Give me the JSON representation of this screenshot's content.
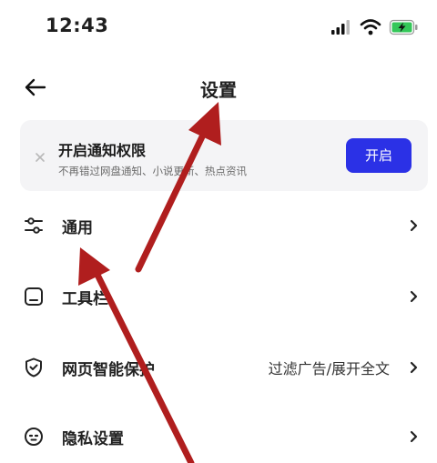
{
  "status_bar": {
    "time": "12:43",
    "icons": [
      "signal-icon",
      "wifi-icon",
      "battery-charging-icon"
    ],
    "battery_color": "#34c759"
  },
  "header": {
    "title": "设置",
    "back_icon": "back-arrow-icon"
  },
  "notification_card": {
    "title": "开启通知权限",
    "subtitle": "不再错过网盘通知、小说更新、热点资讯",
    "button_label": "开启",
    "button_color": "#2b31e6",
    "close_icon": "close-icon"
  },
  "menu": {
    "items": [
      {
        "label": "通用",
        "value": "",
        "icon": "sliders-icon"
      },
      {
        "label": "工具栏",
        "value": "",
        "icon": "toolbar-icon"
      },
      {
        "label": "网页智能保护",
        "value": "过滤广告/展开全文",
        "icon": "shield-check-icon"
      },
      {
        "label": "隐私设置",
        "value": "",
        "icon": "privacy-icon"
      }
    ]
  },
  "annotations": {
    "arrow_color": "#b01e1e"
  }
}
